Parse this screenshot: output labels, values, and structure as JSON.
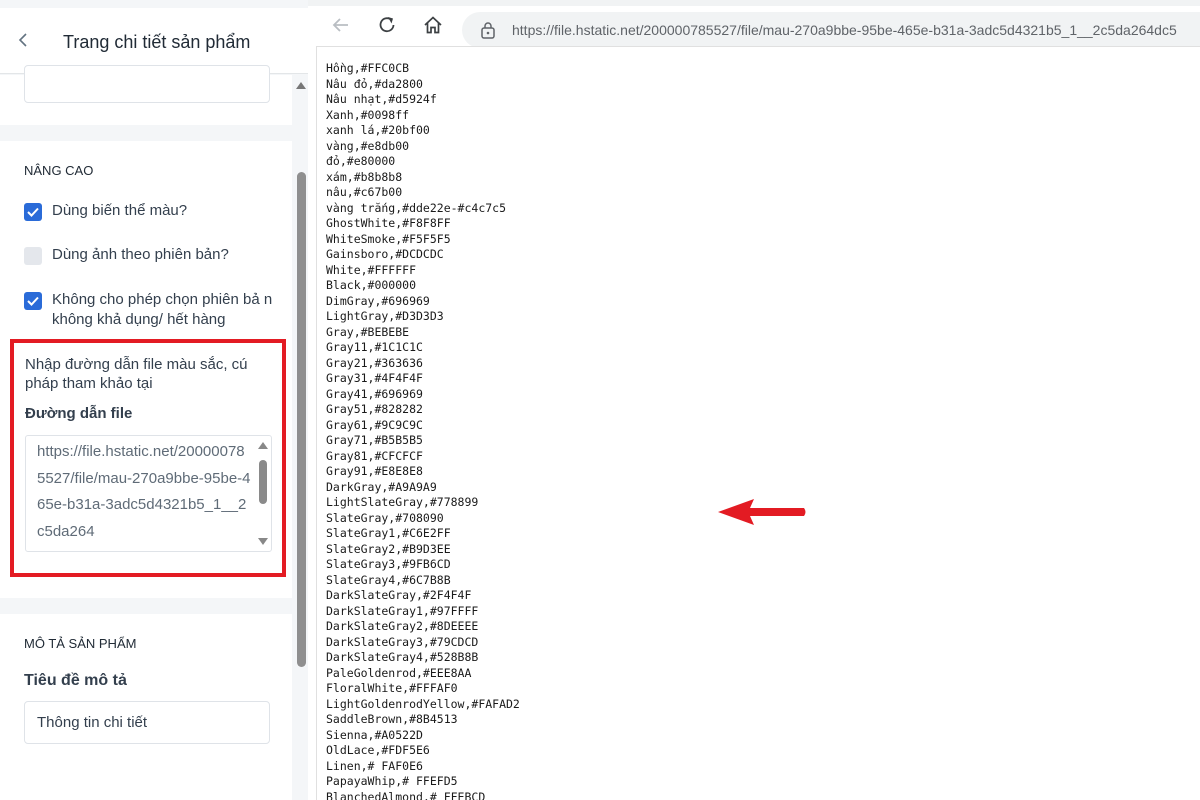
{
  "left_panel": {
    "header_title": "Trang chi tiết sản phẩm",
    "advanced": {
      "section_title": "NÂNG CAO",
      "options": [
        {
          "label": "Dùng biến thể màu?",
          "checked": true
        },
        {
          "label": "Dùng ảnh theo phiên bản?",
          "checked": false
        },
        {
          "label": "Không cho phép chọn phiên bả n không khả dụng/ hết hàng",
          "checked": true
        }
      ],
      "path_description": "Nhập đường dẫn file màu sắc, cú pháp tham khảo tại",
      "path_label": "Đường dẫn file",
      "path_value": "https://file.hstatic.net/200000785527/file/mau-270a9bbe-95be-465e-b31a-3adc5d4321b5_1__2c5da264"
    },
    "description": {
      "section_title": "MÔ TẢ SẢN PHẨM",
      "subtitle_label": "Tiêu đề mô tả",
      "subtitle_value": "Thông tin chi tiết"
    },
    "icons": {
      "back": "chevron-left-icon"
    }
  },
  "browser": {
    "url": "https://file.hstatic.net/200000785527/file/mau-270a9bbe-95be-465e-b31a-3adc5d4321b5_1__2c5da264dc5",
    "icons": {
      "back": "arrow-left-icon",
      "reload": "reload-icon",
      "home": "home-icon",
      "site_info": "lock-icon"
    }
  },
  "content": {
    "color_lines": [
      "Hồng,#FFC0CB",
      "Nâu đỏ,#da2800",
      "Nâu nhạt,#d5924f",
      "Xanh,#0098ff",
      "xanh lá,#20bf00",
      "vàng,#e8db00",
      "đỏ,#e80000",
      "xám,#b8b8b8",
      "nâu,#c67b00",
      "vàng trắng,#dde22e-#c4c7c5",
      "GhostWhite,#F8F8FF",
      "WhiteSmoke,#F5F5F5",
      "Gainsboro,#DCDCDC",
      "White,#FFFFFF",
      "Black,#000000",
      "DimGray,#696969",
      "LightGray,#D3D3D3",
      "Gray,#BEBEBE",
      "Gray11,#1C1C1C",
      "Gray21,#363636",
      "Gray31,#4F4F4F",
      "Gray41,#696969",
      "Gray51,#828282",
      "Gray61,#9C9C9C",
      "Gray71,#B5B5B5",
      "Gray81,#CFCFCF",
      "Gray91,#E8E8E8",
      "DarkGray,#A9A9A9",
      "LightSlateGray,#778899",
      "SlateGray,#708090",
      "SlateGray1,#C6E2FF",
      "SlateGray2,#B9D3EE",
      "SlateGray3,#9FB6CD",
      "SlateGray4,#6C7B8B",
      "DarkSlateGray,#2F4F4F",
      "DarkSlateGray1,#97FFFF",
      "DarkSlateGray2,#8DEEEE",
      "DarkSlateGray3,#79CDCD",
      "DarkSlateGray4,#528B8B",
      "PaleGoldenrod,#EEE8AA",
      "FloralWhite,#FFFAF0",
      "LightGoldenrodYellow,#FAFAD2",
      "SaddleBrown,#8B4513",
      "Sienna,#A0522D",
      "OldLace,#FDF5E6",
      "Linen,# FAF0E6",
      "PapayaWhip,# FFEFD5",
      "BlanchedAlmond,# FFEBCD"
    ],
    "annotation_arrow_color": "#e31b23",
    "highlight_box_color": "#e31b23"
  },
  "colors": {
    "checkbox_checked": "#2a6bd8",
    "checkbox_unchecked": "#e4e7ec",
    "panel_bg": "#f4f6f8"
  }
}
